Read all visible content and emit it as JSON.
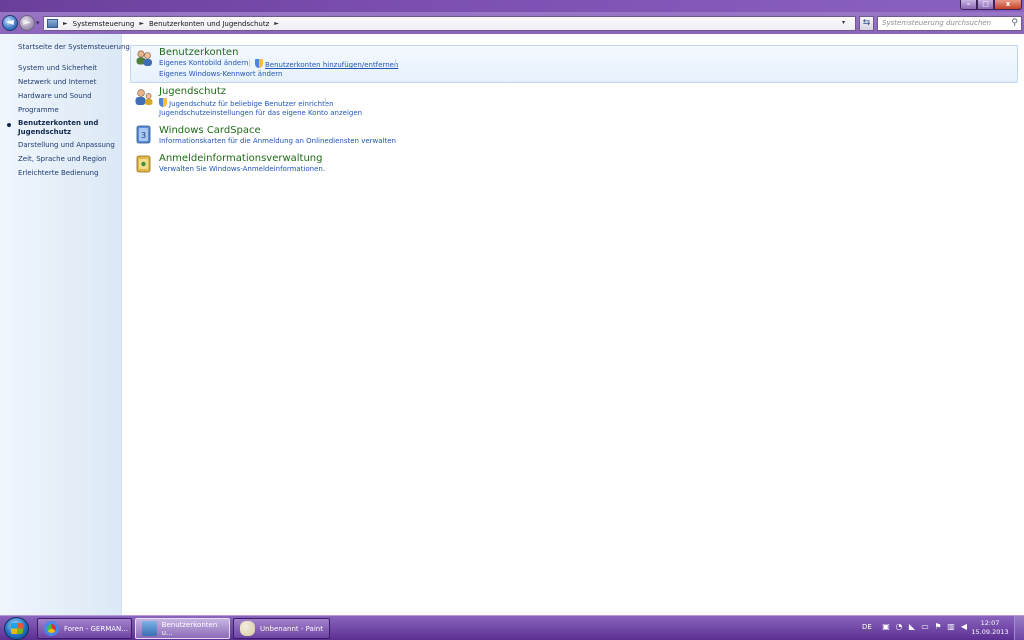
{
  "window": {
    "caption_buttons": {
      "minimize": "–",
      "maximize": "□",
      "close": "x"
    }
  },
  "navbar": {
    "back_glyph": "◄",
    "forward_glyph": "►",
    "recent_glyph": "▾",
    "breadcrumbs": [
      "Systemsteuerung",
      "Benutzerkonten und Jugendschutz"
    ],
    "crumb_separator": "►",
    "address_dropdown_glyph": "▾",
    "refresh_glyph": "⇆",
    "search_placeholder": "Systemsteuerung durchsuchen",
    "search_glyph": "⚲"
  },
  "sidebar": {
    "items": [
      {
        "label": "Startseite der Systemsteuerung"
      },
      {
        "label": "System und Sicherheit"
      },
      {
        "label": "Netzwerk und Internet"
      },
      {
        "label": "Hardware und Sound"
      },
      {
        "label": "Programme"
      },
      {
        "label": "Benutzerkonten und",
        "label2": "Jugendschutz",
        "active": true
      },
      {
        "label": "Darstellung und Anpassung"
      },
      {
        "label": "Zeit, Sprache und Region"
      },
      {
        "label": "Erleichterte Bedienung"
      }
    ]
  },
  "categories": [
    {
      "title": "Benutzerkonten",
      "icon": "user-accounts-icon",
      "links": [
        "Eigenes Kontobild ändern",
        "Benutzerkonten hinzufügen/entfernen",
        "Eigenes Windows-Kennwort ändern"
      ]
    },
    {
      "title": "Jugendschutz",
      "icon": "parental-controls-icon",
      "links": [
        "Jugendschutz für beliebige Benutzer einrichten",
        "Jugendschutzeinstellungen für das eigene Konto anzeigen"
      ]
    },
    {
      "title": "Windows CardSpace",
      "icon": "cardspace-icon",
      "links": [
        "Informationskarten für die Anmeldung an Onlinediensten verwalten"
      ]
    },
    {
      "title": "Anmeldeinformationsverwaltung",
      "icon": "credential-manager-icon",
      "links": [
        "Verwalten Sie Windows-Anmeldeinformationen."
      ]
    }
  ],
  "taskbar": {
    "buttons": [
      {
        "label": "Foren - GERMAN...",
        "icon": "chrome-icon"
      },
      {
        "label": "Benutzerkonten u...",
        "icon": "control-panel-icon",
        "active": true
      },
      {
        "label": "Unbenannt - Paint",
        "icon": "paint-icon"
      }
    ],
    "language": "DE",
    "clock_time": "12:07",
    "clock_date": "15.09.2013"
  }
}
